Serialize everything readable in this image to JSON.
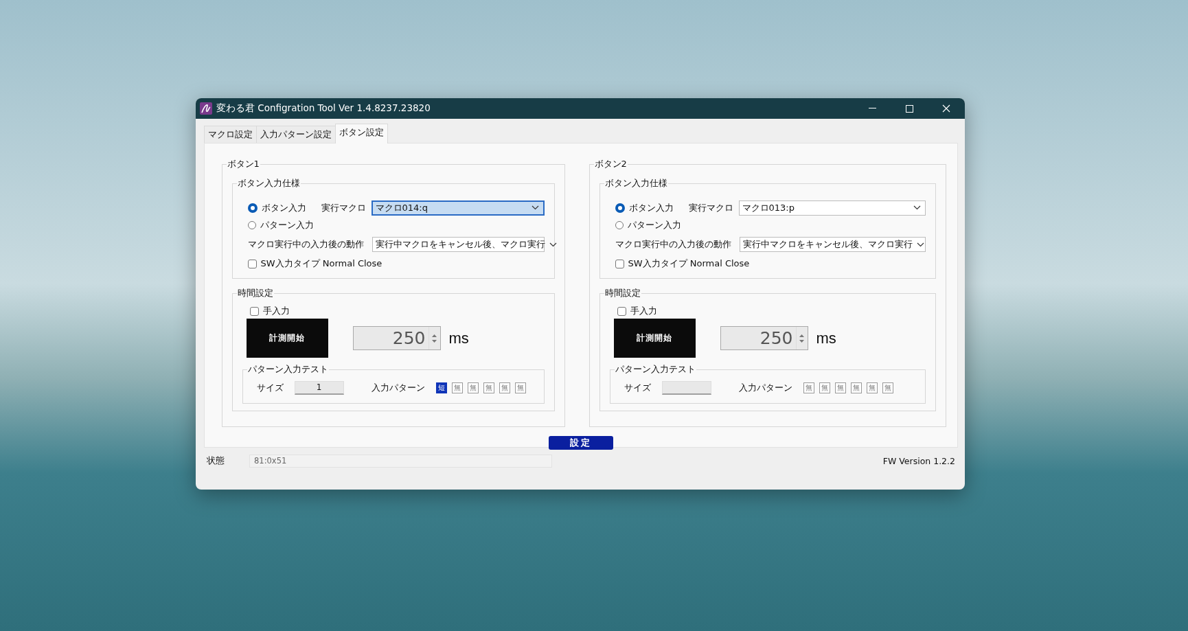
{
  "window": {
    "title": "変わる君 Configration Tool Ver 1.4.8237.23820"
  },
  "tabs": [
    {
      "label": "マクロ設定",
      "selected": false
    },
    {
      "label": "入力パターン設定",
      "selected": false
    },
    {
      "label": "ボタン設定",
      "selected": true
    }
  ],
  "panels": [
    {
      "title": "ボタン1",
      "input_spec": {
        "title": "ボタン入力仕様",
        "modes": [
          {
            "label": "ボタン入力",
            "selected": true
          },
          {
            "label": "パターン入力",
            "selected": false
          }
        ],
        "macro_label": "実行マクロ",
        "macro": {
          "value": "マクロ014:q",
          "focused": true
        },
        "action_label": "マクロ実行中の入力後の動作",
        "action": {
          "value": "実行中マクロをキャンセル後、マクロ実行",
          "focused": false
        },
        "switch_type": {
          "label": "SW入力タイプ Normal Close",
          "checked": false
        }
      },
      "timing": {
        "title": "時間設定",
        "manual": {
          "label": "手入力",
          "checked": false
        },
        "measure_button": "計測開始",
        "time": {
          "value": "250",
          "disabled": true
        },
        "unit": "ms",
        "pattern_test": {
          "title": "パターン入力テスト",
          "size_label": "サイズ",
          "size_value": "1",
          "pattern_label": "入力パターン",
          "cells": [
            {
              "label": "短",
              "selected": true
            },
            {
              "label": "無",
              "selected": false
            },
            {
              "label": "無",
              "selected": false
            },
            {
              "label": "無",
              "selected": false
            },
            {
              "label": "無",
              "selected": false
            },
            {
              "label": "無",
              "selected": false
            }
          ]
        }
      }
    },
    {
      "title": "ボタン2",
      "input_spec": {
        "title": "ボタン入力仕様",
        "modes": [
          {
            "label": "ボタン入力",
            "selected": true
          },
          {
            "label": "パターン入力",
            "selected": false
          }
        ],
        "macro_label": "実行マクロ",
        "macro": {
          "value": "マクロ013:p",
          "focused": false
        },
        "action_label": "マクロ実行中の入力後の動作",
        "action": {
          "value": "実行中マクロをキャンセル後、マクロ実行",
          "focused": false
        },
        "switch_type": {
          "label": "SW入力タイプ Normal Close",
          "checked": false
        }
      },
      "timing": {
        "title": "時間設定",
        "manual": {
          "label": "手入力",
          "checked": false
        },
        "measure_button": "計測開始",
        "time": {
          "value": "250",
          "disabled": true
        },
        "unit": "ms",
        "pattern_test": {
          "title": "パターン入力テスト",
          "size_label": "サイズ",
          "pattern_label": "入力パターン",
          "cells": [
            {
              "label": "無",
              "selected": false
            },
            {
              "label": "無",
              "selected": false
            },
            {
              "label": "無",
              "selected": false
            },
            {
              "label": "無",
              "selected": false
            },
            {
              "label": "無",
              "selected": false
            },
            {
              "label": "無",
              "selected": false
            }
          ]
        }
      }
    }
  ],
  "apply_button": "設定",
  "status_bar": {
    "label": "状態",
    "value": "81:0x51",
    "fw_version": "FW Version 1.2.2"
  }
}
